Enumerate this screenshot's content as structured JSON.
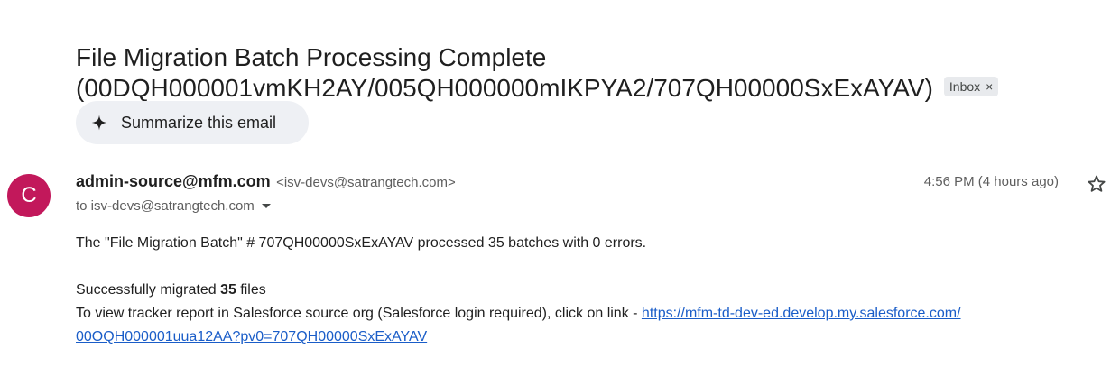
{
  "email": {
    "subject_line1": "File Migration Batch Processing Complete",
    "subject_line2": "(00DQH000001vmKH2AY/005QH000000mIKPYA2/707QH00000SxExAYAV)",
    "label": "Inbox",
    "label_remove": "×",
    "summarize_label": "Summarize this email",
    "avatar_letter": "C",
    "avatar_color": "#c2185b",
    "sender_name": "admin-source@mfm.com",
    "sender_email": "<isv-devs@satrangtech.com>",
    "to": "to isv-devs@satrangtech.com",
    "time": "4:56 PM (4 hours ago)",
    "body": {
      "line1": "The \"File Migration Batch\" # 707QH00000SxExAYAV processed 35 batches with 0 errors.",
      "migrated_prefix": "Successfully migrated ",
      "migrated_count": "35",
      "migrated_suffix": " files",
      "tracker_text": "To view tracker report in Salesforce source org (Salesforce login required), click on link - ",
      "link_part1": "https://mfm-td-dev-ed.develop.my.salesforce.com/",
      "link_part2": "00OQH000001uua12AA?pv0=707QH00000SxExAYAV"
    }
  },
  "icons": {
    "summarize": "sparkle-icon",
    "star": "star-icon",
    "caret": "chevron-down-icon"
  },
  "colors": {
    "link": "#1a5dc8",
    "chip_bg": "#e8eaed",
    "summarize_bg": "#eef0f4"
  }
}
